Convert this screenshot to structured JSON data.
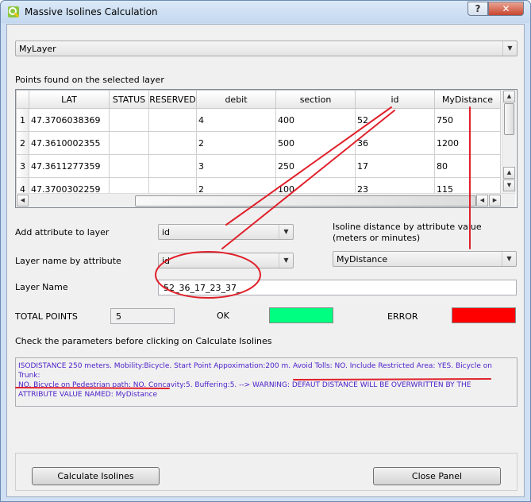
{
  "window": {
    "title": "Massive Isolines Calculation",
    "help_label": "?",
    "close_label": "✕"
  },
  "layer_select": {
    "value": "MyLayer"
  },
  "points_label": "Points found on the selected layer",
  "table": {
    "columns": [
      "LAT",
      "STATUS",
      "RESERVED",
      "debit",
      "section",
      "id",
      "MyDistance"
    ],
    "rows": [
      {
        "num": "1",
        "cells": [
          "47.3706038369",
          "",
          "",
          "4",
          "400",
          "52",
          "750"
        ]
      },
      {
        "num": "2",
        "cells": [
          "47.3610002355",
          "",
          "",
          "2",
          "500",
          "36",
          "1200"
        ]
      },
      {
        "num": "3",
        "cells": [
          "47.3611277359",
          "",
          "",
          "3",
          "250",
          "17",
          "80"
        ]
      },
      {
        "num": "4",
        "cells": [
          "47.3700302259",
          "",
          "",
          "2",
          "100",
          "23",
          "115"
        ]
      }
    ]
  },
  "form": {
    "add_attr_label": "Add attribute to layer",
    "add_attr_value": "id",
    "layer_name_attr_label": "Layer name by attribute",
    "layer_name_attr_value": "id",
    "isoline_label_1": "Isoline distance by attribute value",
    "isoline_label_2": "(meters or minutes)",
    "isoline_value": "MyDistance",
    "layer_name_label": "Layer Name",
    "layer_name_value": "52_36_17_23_37_",
    "total_points_label": "TOTAL POINTS",
    "total_points_value": "5",
    "ok_label": "OK",
    "error_label": "ERROR",
    "ok_color": "#00ff80",
    "error_color": "#ff0000"
  },
  "check_label": "Check the parameters before clicking on Calculate Isolines",
  "notes": {
    "line1": "ISODISTANCE 250 meters. Mobility:Bicycle. Start Point Appoximation:200 m. Avoid Tolls: NO.  Include Restricted Area: YES.  Bicycle on Trunk:",
    "line2": "NO.  Bicycle on Pedestrian path: NO.  Concavity:5.  Buffering:5.   --> WARNING: DEFAUT DISTANCE WILL BE OVERWRITTEN BY THE",
    "line3": "ATTRIBUTE VALUE NAMED: MyDistance"
  },
  "buttons": {
    "calculate": "Calculate Isolines",
    "close_panel": "Close Panel"
  },
  "annotation_color": "#e0202a"
}
